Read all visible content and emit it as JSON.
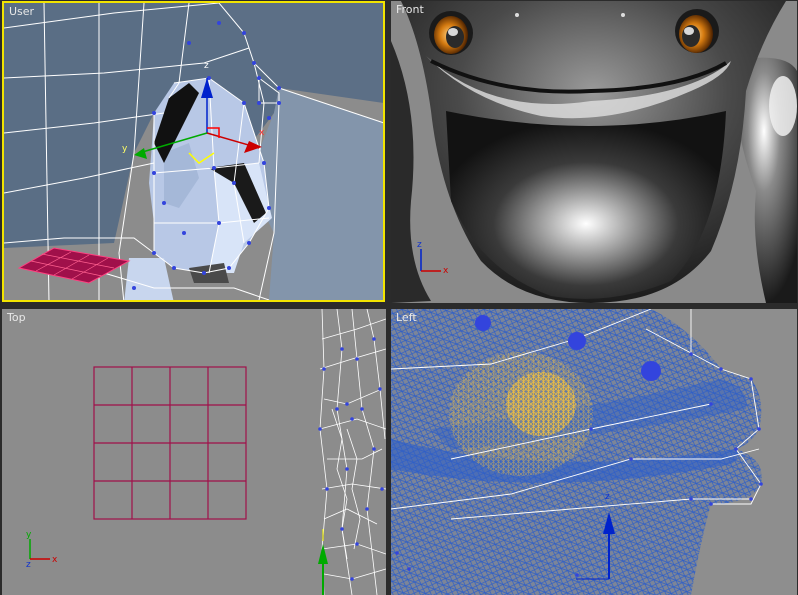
{
  "viewports": {
    "user": {
      "label": "User"
    },
    "front": {
      "label": "Front"
    },
    "top": {
      "label": "Top"
    },
    "left": {
      "label": "Left"
    }
  },
  "axes": {
    "x": "x",
    "y": "y",
    "z": "z"
  },
  "colors": {
    "active_border": "#f2e400",
    "viewport_bg": "#8c8c8c",
    "wire_white": "#ffffff",
    "wire_blue": "#2f5fc8",
    "vertex_blue": "#3344dd",
    "gizmo_red": "#cc0000",
    "gizmo_green": "#00aa00",
    "gizmo_blue": "#0022cc",
    "grid_maroon": "#a0104a",
    "eye_gold": "#f0c040"
  }
}
